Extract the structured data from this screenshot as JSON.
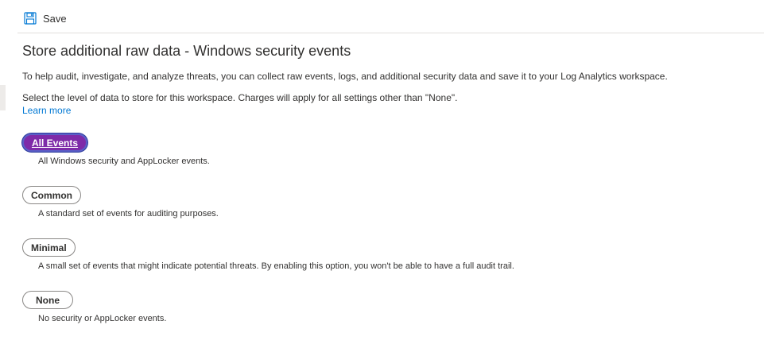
{
  "toolbar": {
    "save_label": "Save",
    "save_icon": "save-icon"
  },
  "content": {
    "title": "Store additional raw data - Windows security events",
    "description": "To help audit, investigate, and analyze threats, you can collect raw events, logs, and additional security data and save it to your Log Analytics workspace.",
    "select_text": "Select the level of data to store for this workspace. Charges will apply for all settings other than \"None\".",
    "learn_more": "Learn more"
  },
  "options": [
    {
      "label": "All Events",
      "description": "All Windows security and AppLocker events.",
      "selected": true
    },
    {
      "label": "Common",
      "description": "A standard set of events for auditing purposes.",
      "selected": false
    },
    {
      "label": "Minimal",
      "description": "A small set of events that might indicate potential threats. By enabling this option, you won't be able to have a full audit trail.",
      "selected": false
    },
    {
      "label": "None",
      "description": "No security or AppLocker events.",
      "selected": false
    }
  ],
  "colors": {
    "accent": "#0078d4",
    "selected_fill": "#7e2aa8",
    "selected_ring": "#5b5fc7"
  }
}
